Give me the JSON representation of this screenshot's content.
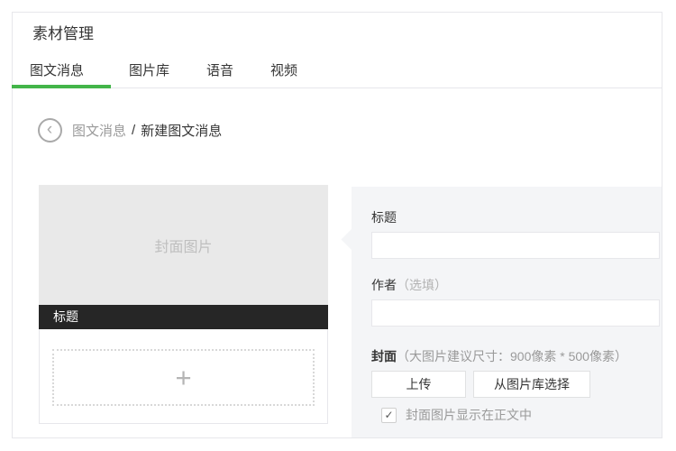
{
  "header": {
    "title": "素材管理"
  },
  "tabs": [
    {
      "label": "图文消息",
      "active": true
    },
    {
      "label": "图片库",
      "active": false
    },
    {
      "label": "语音",
      "active": false
    },
    {
      "label": "视频",
      "active": false
    }
  ],
  "breadcrumb": {
    "parent": "图文消息",
    "separator": "/",
    "current": "新建图文消息"
  },
  "preview": {
    "cover_placeholder": "封面图片",
    "title_bar_text": "标题"
  },
  "form": {
    "title": {
      "label": "标题",
      "value": ""
    },
    "author": {
      "label": "作者",
      "optional_hint": "（选填）",
      "value": ""
    },
    "cover": {
      "label": "封面",
      "size_hint": "（大图片建议尺寸：900像素 * 500像素）"
    },
    "buttons": {
      "upload": "上传",
      "choose_from_library": "从图片库选择"
    },
    "checkbox": {
      "label": "封面图片显示在正文中",
      "checked": true
    }
  },
  "icons": {
    "back_arrow": "‹",
    "plus": "+",
    "checkmark": "✓"
  },
  "colors": {
    "accent_green": "#43b549",
    "panel_bg": "#f4f5f7",
    "title_bar_bg": "#262626",
    "border": "#e7e7eb"
  }
}
